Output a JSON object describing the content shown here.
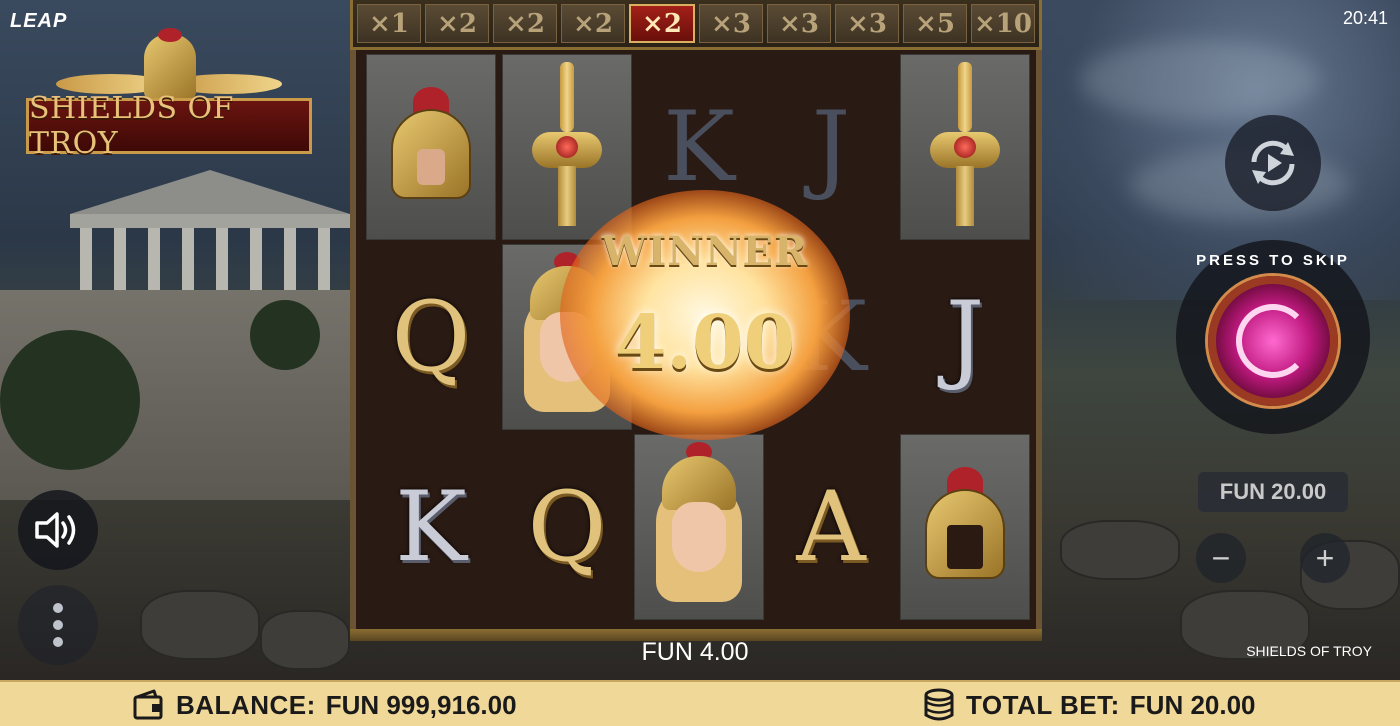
{
  "top": {
    "brand": "LEAP",
    "clock": "20:41"
  },
  "logo": {
    "title": "SHIELDS OF TROY"
  },
  "multipliers": [
    {
      "label": "×1",
      "active": false
    },
    {
      "label": "×2",
      "active": false
    },
    {
      "label": "×2",
      "active": false
    },
    {
      "label": "×2",
      "active": false
    },
    {
      "label": "×2",
      "active": true
    },
    {
      "label": "×3",
      "active": false
    },
    {
      "label": "×3",
      "active": false
    },
    {
      "label": "×3",
      "active": false
    },
    {
      "label": "×5",
      "active": false
    },
    {
      "label": "×10",
      "active": false
    }
  ],
  "reels": {
    "symbols": [
      [
        "helmet-warrior",
        "Q",
        "K"
      ],
      [
        "sword",
        "woman-warrior",
        "Q"
      ],
      [
        "K",
        "",
        "woman-warrior"
      ],
      [
        "J",
        "K",
        "A"
      ],
      [
        "sword",
        "J",
        "golden-helmet"
      ]
    ],
    "letters": {
      "K": "K",
      "J": "J",
      "Q": "Q",
      "A": "A"
    }
  },
  "win": {
    "title": "WINNER",
    "amount": "4.00",
    "line": "FUN 4.00"
  },
  "controls": {
    "skip_label": "PRESS TO SKIP",
    "bet": "FUN 20.00",
    "minus": "−",
    "plus": "+",
    "game_name": "SHIELDS OF TROY"
  },
  "footer": {
    "balance_label": "BALANCE:",
    "balance_value": "FUN 999,916.00",
    "bet_label": "TOTAL BET:",
    "bet_value": "FUN 20.00"
  },
  "icons": {
    "autoplay": "autoplay-icon",
    "sound": "speaker-icon",
    "menu": "more-vertical-icon",
    "wallet": "wallet-icon",
    "coins": "coins-icon"
  },
  "colors": {
    "footer_bg": "#f0d898",
    "active_multiplier": "#a32018",
    "gold": "#e0c27c",
    "skip_orb": "#c01a80"
  }
}
